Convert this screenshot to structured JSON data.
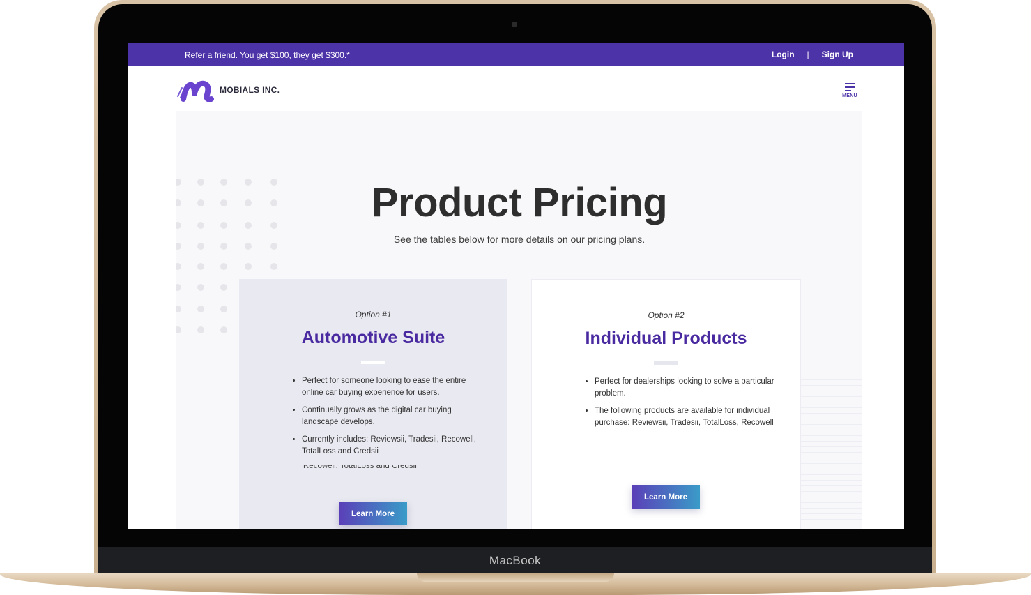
{
  "device": {
    "label": "MacBook"
  },
  "promo": {
    "text": "Refer a friend. You get $100, they get $300.*",
    "login": "Login",
    "separator": "|",
    "signup": "Sign Up"
  },
  "brand": {
    "name": "MOBIALS INC.",
    "color": "#4d33a8"
  },
  "menu": {
    "label": "MENU",
    "icon": "hamburger-icon"
  },
  "hero": {
    "title": "Product Pricing",
    "subtitle": "See the tables below for more details on our pricing plans."
  },
  "plans": [
    {
      "option": "Option #1",
      "title": "Automotive Suite",
      "features": [
        "Perfect for someone looking to ease the entire online car buying experience for users.",
        "Continually grows as the digital car buying landscape develops.",
        "Currently includes: Reviewsii, Tradesii, Recowell, TotalLoss and Credsii"
      ],
      "ghost_text": "Recowell, TotalLoss and Credsii",
      "button": "Learn More"
    },
    {
      "option": "Option #2",
      "title": "Individual Products",
      "features": [
        "Perfect for dealerships looking to solve a particular problem.",
        "The following products are available for individual purchase: Reviewsii, Tradesii, TotalLoss, Recowell"
      ],
      "button": "Learn More"
    }
  ]
}
